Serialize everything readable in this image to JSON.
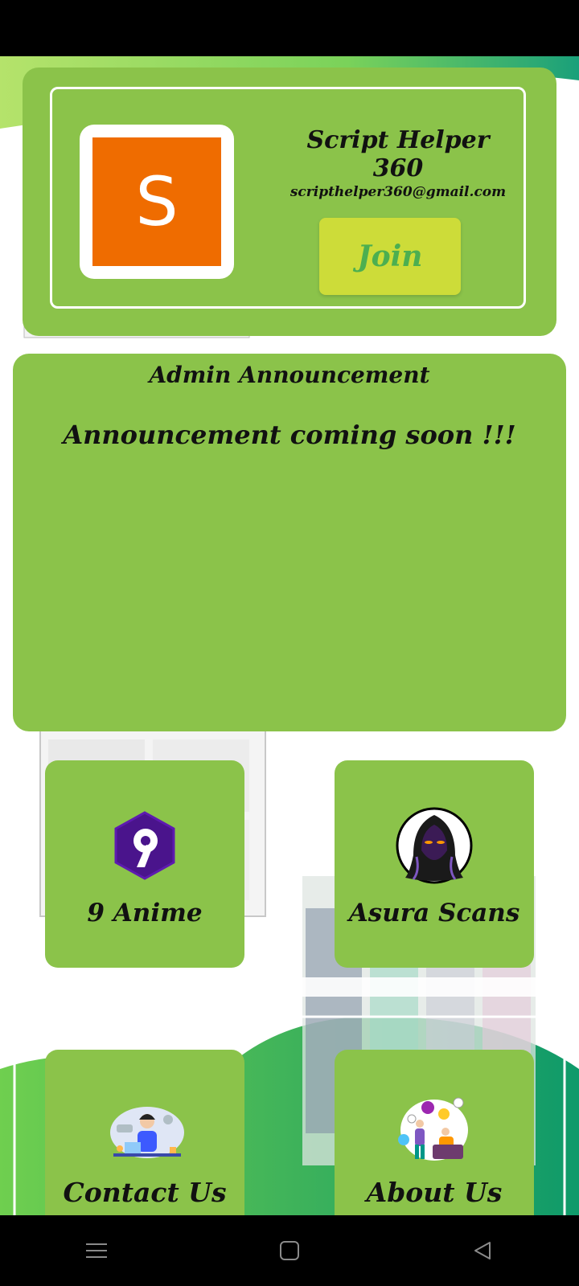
{
  "profile": {
    "avatar_letter": "S",
    "name": "Script Helper 360",
    "email": "scripthelper360@gmail.com",
    "join_label": "Join"
  },
  "announcement": {
    "title": "Admin Announcement",
    "body": "Announcement coming soon !!!"
  },
  "tiles": [
    {
      "label": "9 Anime",
      "icon": "nine-anime-logo-icon"
    },
    {
      "label": "Asura Scans",
      "icon": "hooded-figure-icon"
    },
    {
      "label": "Contact Us",
      "icon": "support-agent-icon"
    },
    {
      "label": "About Us",
      "icon": "team-chat-icon"
    }
  ],
  "nav": {
    "icons": [
      "menu-icon",
      "home-square-icon",
      "back-triangle-icon"
    ]
  },
  "colors": {
    "card_green": "#8bc34a",
    "join_yellow": "#cddc39",
    "join_text": "#4caf50",
    "avatar_orange": "#ef6c00",
    "nine_anime_purple": "#4a148c"
  }
}
